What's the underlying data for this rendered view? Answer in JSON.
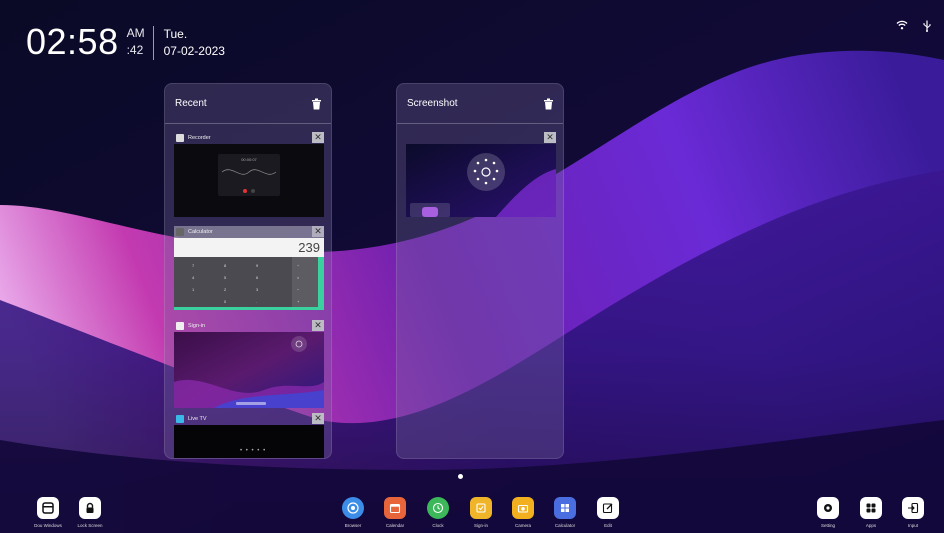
{
  "status": {
    "time": "02:58",
    "ampm": "AM",
    "seconds": ":42",
    "weekday": "Tue.",
    "date": "07-02-2023"
  },
  "recent": {
    "title": "Recent",
    "items": [
      {
        "label": "Recorder",
        "preview_time": "00:00:07"
      },
      {
        "label": "Calculator",
        "display_value": "239"
      },
      {
        "label": "Sign-in"
      },
      {
        "label": "Live TV"
      }
    ],
    "scroll_hint": "• • • • •"
  },
  "screenshot": {
    "title": "Screenshot"
  },
  "dock": {
    "left": [
      {
        "label": "Dou Windows",
        "icon": "windows-icon"
      },
      {
        "label": "Lock Screen",
        "icon": "lock-icon"
      }
    ],
    "center": [
      {
        "label": "Browser",
        "icon": "browser-icon",
        "color": "#3b8de8"
      },
      {
        "label": "Calendar",
        "icon": "calendar-icon",
        "color": "#e8653b"
      },
      {
        "label": "Clock",
        "icon": "clock-icon",
        "color": "#3cb85a"
      },
      {
        "label": "Sign-in",
        "icon": "sign-in-icon",
        "color": "#f0b429"
      },
      {
        "label": "Camera",
        "icon": "camera-icon",
        "color": "#f2b01e"
      },
      {
        "label": "Calculator",
        "icon": "calculator-icon",
        "color": "#4a6de0"
      },
      {
        "label": "Edit",
        "icon": "edit-icon",
        "color": "#ffffff"
      }
    ],
    "right": [
      {
        "label": "Setting",
        "icon": "settings-icon"
      },
      {
        "label": "Apps",
        "icon": "apps-icon"
      },
      {
        "label": "Input",
        "icon": "input-icon"
      }
    ]
  }
}
